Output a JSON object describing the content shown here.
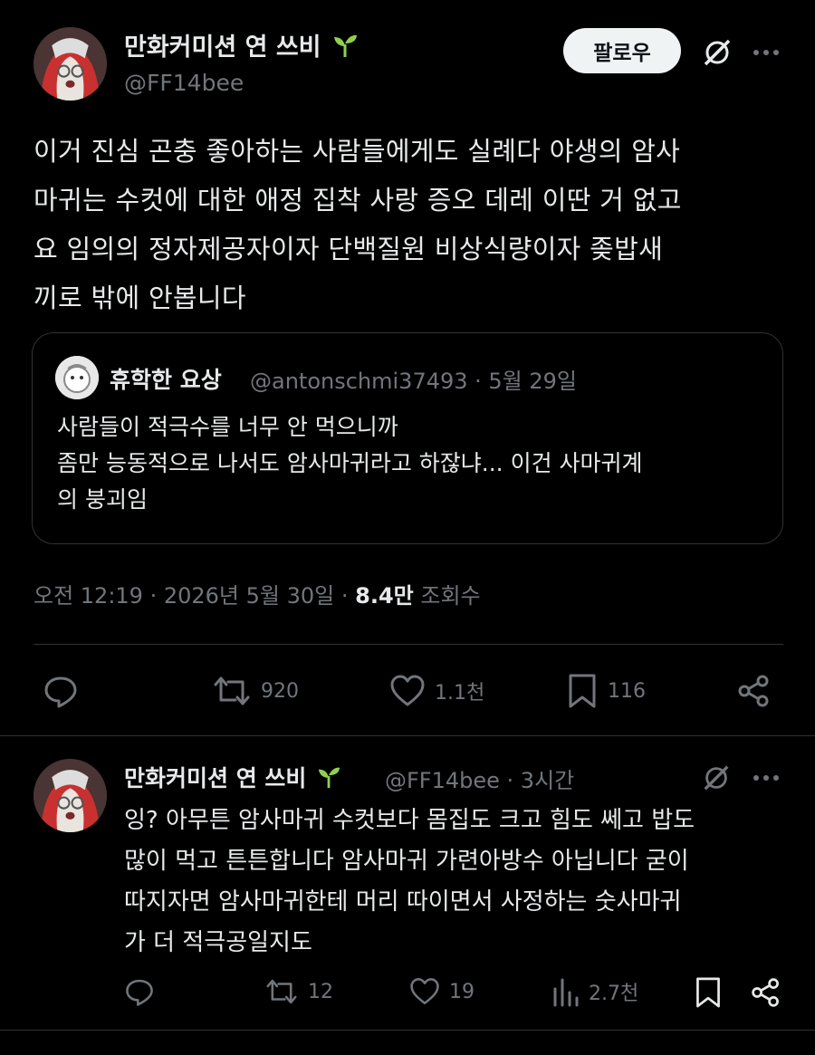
{
  "main_tweet": {
    "author_name": "만화커미션 연 쓰비",
    "handle": "@FF14bee",
    "follow_label": "팔로우",
    "body_lines": [
      "이거 진심 곤충 좋아하는 사람들에게도 실례다 야생의 암사",
      "마귀는 수컷에 대한 애정 집착 사랑 증오 데레 이딴 거 없고",
      "요 임의의 정자제공자이자 단백질원 비상식량이자 좆밥새",
      "끼로 밖에 안봅니다"
    ],
    "quote": {
      "name": "휴학한 요상",
      "meta": "@antonschmi37493 · 5월 29일",
      "lines": [
        "사람들이 적극수를 너무 안 먹으니까",
        "좀만 능동적으로 나서도 암사마귀라고 하잖냐... 이건 사마귀계",
        "의 붕괴임"
      ]
    },
    "timestamp": "오전 12:19 · 2026년 5월 30일 · ",
    "views_count": "8.4만",
    "views_label": " 조회수",
    "stats": {
      "retweets": "920",
      "likes": "1.1천",
      "bookmarks": "116"
    }
  },
  "reply": {
    "author_name": "만화커미션 연 쓰비",
    "meta": "@FF14bee · 3시간",
    "body_lines": [
      "잉? 아무튼 암사마귀 수컷보다 몸집도 크고 힘도 쎄고 밥도",
      "많이 먹고 튼튼합니다 암사마귀 가련아방수 아닙니다 굳이",
      "따지자면 암사마귀한테 머리 따이면서 사정하는 숫사마귀",
      "가 더 적극공일지도"
    ],
    "stats": {
      "retweets": "12",
      "likes": "19",
      "views": "2.7천"
    }
  },
  "colors": {
    "background": "#000000",
    "text": "#e7e9ea",
    "muted": "#71767b",
    "divider": "#2f3336",
    "sprout": "#8fd14f"
  },
  "icons": [
    "sprout-icon",
    "grok-icon",
    "more-icon",
    "reply-icon",
    "retweet-icon",
    "like-icon",
    "bookmark-icon",
    "share-icon",
    "views-icon"
  ]
}
